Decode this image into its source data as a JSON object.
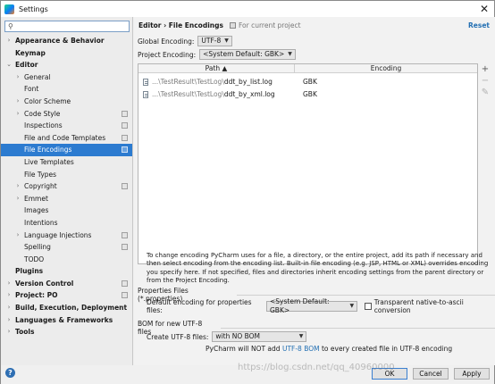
{
  "window": {
    "title": "Settings"
  },
  "search": {
    "placeholder": ""
  },
  "sidebar": {
    "items": [
      {
        "label": "Appearance & Behavior",
        "arrow": "›",
        "bold": true
      },
      {
        "label": "Keymap",
        "arrow": "",
        "bold": true
      },
      {
        "label": "Editor",
        "arrow": "⌄",
        "bold": true
      },
      {
        "label": "General",
        "arrow": "›"
      },
      {
        "label": "Font",
        "arrow": ""
      },
      {
        "label": "Color Scheme",
        "arrow": "›"
      },
      {
        "label": "Code Style",
        "arrow": "›",
        "project": true
      },
      {
        "label": "Inspections",
        "arrow": "",
        "project": true
      },
      {
        "label": "File and Code Templates",
        "arrow": "",
        "project": true
      },
      {
        "label": "File Encodings",
        "arrow": "",
        "project": true,
        "selected": true
      },
      {
        "label": "Live Templates",
        "arrow": ""
      },
      {
        "label": "File Types",
        "arrow": ""
      },
      {
        "label": "Copyright",
        "arrow": "›",
        "project": true
      },
      {
        "label": "Emmet",
        "arrow": "›"
      },
      {
        "label": "Images",
        "arrow": ""
      },
      {
        "label": "Intentions",
        "arrow": ""
      },
      {
        "label": "Language Injections",
        "arrow": "›",
        "project": true
      },
      {
        "label": "Spelling",
        "arrow": "",
        "project": true
      },
      {
        "label": "TODO",
        "arrow": ""
      },
      {
        "label": "Plugins",
        "arrow": "",
        "bold": true
      },
      {
        "label": "Version Control",
        "arrow": "›",
        "bold": true,
        "project": true
      },
      {
        "label": "Project: PO",
        "arrow": "›",
        "bold": true,
        "project": true
      },
      {
        "label": "Build, Execution, Deployment",
        "arrow": "›",
        "bold": true
      },
      {
        "label": "Languages & Frameworks",
        "arrow": "›",
        "bold": true
      },
      {
        "label": "Tools",
        "arrow": "›",
        "bold": true
      }
    ]
  },
  "header": {
    "breadcrumb": "Editor  ›  File Encodings",
    "note": "For current project",
    "reset": "Reset"
  },
  "global_encoding": {
    "label": "Global Encoding:",
    "value": "UTF-8"
  },
  "project_encoding": {
    "label": "Project Encoding:",
    "value": "<System Default: GBK>"
  },
  "table": {
    "col_path": "Path ▲",
    "col_encoding": "Encoding",
    "rows": [
      {
        "prefix": "...\\TestResult\\TestLog\\",
        "file": "ddt_by_list.log",
        "encoding": "GBK"
      },
      {
        "prefix": "...\\TestResult\\TestLog\\",
        "file": "ddt_by_xml.log",
        "encoding": "GBK"
      }
    ]
  },
  "info_text": "To change encoding PyCharm uses for a file, a directory, or the entire project, add its path if necessary and then select encoding from the encoding list. Built-in file encoding (e.g. JSP, HTML or XML) overrides encoding you specify here. If not specified, files and directories inherit encoding settings from the parent directory or from the Project Encoding.",
  "properties": {
    "section": "Properties Files (*.properties)",
    "label": "Default encoding for properties files:",
    "value": "<System Default: GBK>",
    "checkbox_label": "Transparent native-to-ascii conversion"
  },
  "bom": {
    "section": "BOM for new UTF-8 files",
    "label": "Create UTF-8 files:",
    "value": "with NO BOM",
    "note_pre": "PyCharm will NOT add ",
    "note_link": "UTF-8 BOM",
    "note_post": " to every created file in UTF-8 encoding"
  },
  "buttons": {
    "ok": "OK",
    "cancel": "Cancel",
    "apply": "Apply",
    "help": "?"
  },
  "watermark": "https://blog.csdn.net/qq_40960000"
}
